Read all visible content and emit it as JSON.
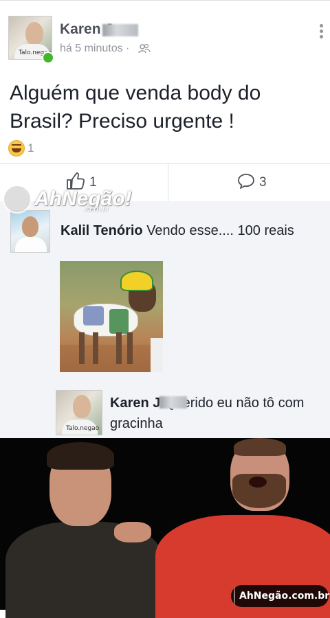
{
  "post": {
    "author": "Karen J",
    "timestamp": "há 5 minutos ·",
    "text": "Alguém que venda body do Brasil? Preciso urgente !",
    "reaction_count": "1"
  },
  "actions": {
    "like_count": "1",
    "comment_count": "3"
  },
  "watermark": {
    "text": "AhNegão!",
    "sub": ".com.br"
  },
  "comments": [
    {
      "author": "Kalil Tenório",
      "text": " Vendo esse.... 100 reais"
    },
    {
      "author": "Karen J",
      "text": " Querido eu não tô com gracinha"
    }
  ],
  "avatar_tag": "Talo.negao",
  "footer": {
    "badge": "AhNegão.com.br"
  },
  "colors": {
    "online": "#42b72a",
    "meme_shirt": "#d63b2e",
    "text_primary": "#1d2129",
    "text_secondary": "#90949c"
  }
}
